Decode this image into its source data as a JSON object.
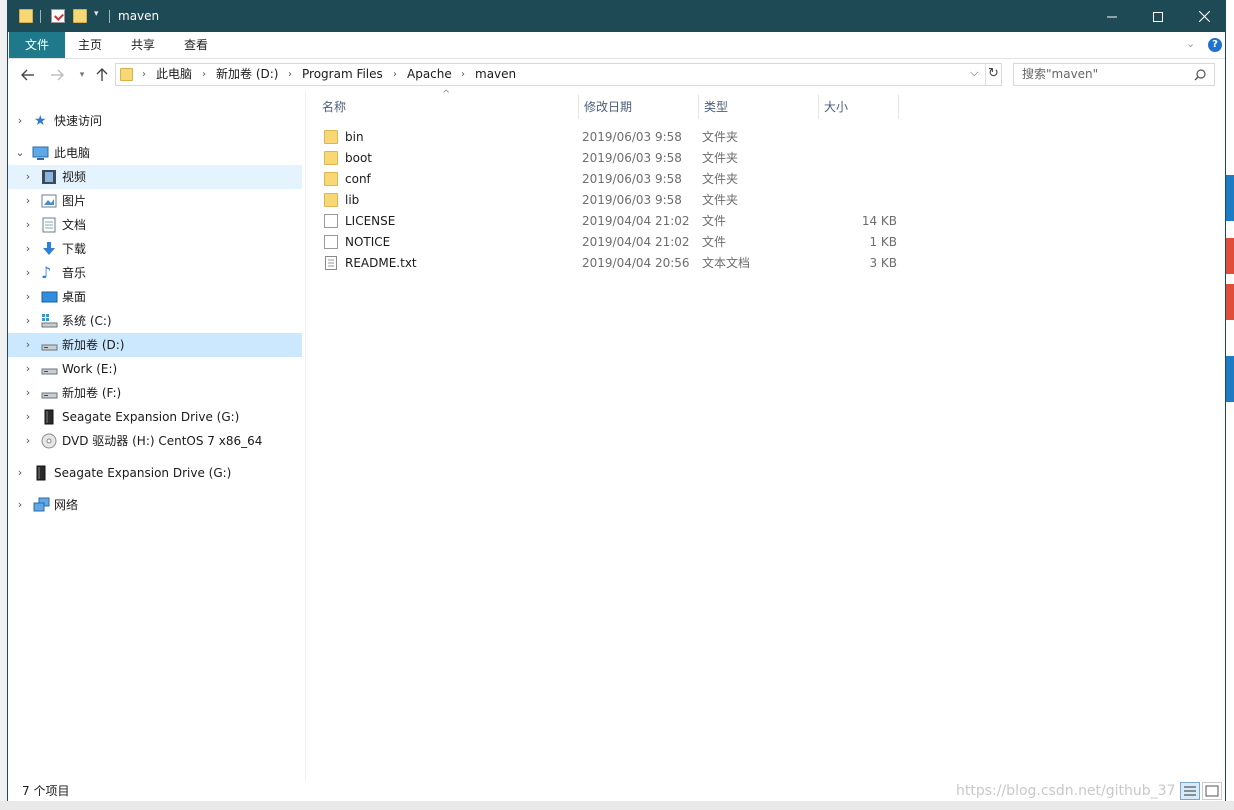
{
  "window": {
    "title": "maven"
  },
  "ribbon": {
    "tabs": [
      "文件",
      "主页",
      "共享",
      "查看"
    ]
  },
  "address": {
    "crumbs": [
      "此电脑",
      "新加卷 (D:)",
      "Program Files",
      "Apache",
      "maven"
    ]
  },
  "search": {
    "placeholder": "搜索\"maven\""
  },
  "nav": {
    "quick_access": "快速访问",
    "this_pc": "此电脑",
    "items": [
      {
        "label": "视频",
        "icon": "video-icon"
      },
      {
        "label": "图片",
        "icon": "pictures-icon"
      },
      {
        "label": "文档",
        "icon": "documents-icon"
      },
      {
        "label": "下载",
        "icon": "download-icon"
      },
      {
        "label": "音乐",
        "icon": "music-icon"
      },
      {
        "label": "桌面",
        "icon": "desktop-icon"
      },
      {
        "label": "系统 (C:)",
        "icon": "system-drive-icon"
      },
      {
        "label": "新加卷 (D:)",
        "icon": "drive-icon"
      },
      {
        "label": "Work (E:)",
        "icon": "drive-icon"
      },
      {
        "label": "新加卷 (F:)",
        "icon": "drive-icon"
      },
      {
        "label": "Seagate Expansion Drive (G:)",
        "icon": "external-drive-icon"
      },
      {
        "label": "DVD 驱动器 (H:) CentOS 7 x86_64",
        "icon": "dvd-icon"
      }
    ],
    "external": "Seagate Expansion Drive (G:)",
    "network": "网络"
  },
  "columns": {
    "name": "名称",
    "date": "修改日期",
    "type": "类型",
    "size": "大小"
  },
  "files": [
    {
      "name": "bin",
      "date": "2019/06/03 9:58",
      "type": "文件夹",
      "size": "",
      "kind": "folder"
    },
    {
      "name": "boot",
      "date": "2019/06/03 9:58",
      "type": "文件夹",
      "size": "",
      "kind": "folder"
    },
    {
      "name": "conf",
      "date": "2019/06/03 9:58",
      "type": "文件夹",
      "size": "",
      "kind": "folder"
    },
    {
      "name": "lib",
      "date": "2019/06/03 9:58",
      "type": "文件夹",
      "size": "",
      "kind": "folder"
    },
    {
      "name": "LICENSE",
      "date": "2019/04/04 21:02",
      "type": "文件",
      "size": "14 KB",
      "kind": "file"
    },
    {
      "name": "NOTICE",
      "date": "2019/04/04 21:02",
      "type": "文件",
      "size": "1 KB",
      "kind": "file"
    },
    {
      "name": "README.txt",
      "date": "2019/04/04 20:56",
      "type": "文本文档",
      "size": "3 KB",
      "kind": "text"
    }
  ],
  "status": {
    "count": "7 个项目",
    "watermark": "https://blog.csdn.net/github_37"
  },
  "colors": {
    "titlebar": "#1e4a55",
    "file_tab": "#1e7a8a",
    "selection": "#cce8ff",
    "folder": "#f8d775"
  }
}
